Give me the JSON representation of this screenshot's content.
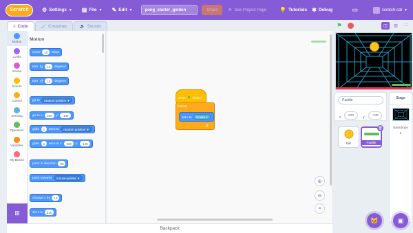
{
  "menu": {
    "logo": "Scratch",
    "settings": "Settings",
    "file": "File",
    "edit": "Edit",
    "project_title": "pong_starter_golden",
    "share": "Share",
    "see_project": "See Project Page",
    "tutorials": "Tutorials",
    "debug": "Debug",
    "username": "scratch-cat"
  },
  "tabs": [
    {
      "label": "Code",
      "icon": "code-icon",
      "active": true
    },
    {
      "label": "Costumes",
      "icon": "brush-icon",
      "active": false
    },
    {
      "label": "Sounds",
      "icon": "speaker-icon",
      "active": false
    }
  ],
  "categories": [
    {
      "label": "Motion",
      "color": "#4c97ff"
    },
    {
      "label": "Looks",
      "color": "#9966ff"
    },
    {
      "label": "Sound",
      "color": "#cf63cf"
    },
    {
      "label": "Events",
      "color": "#ffbf00"
    },
    {
      "label": "Control",
      "color": "#ffab19"
    },
    {
      "label": "Sensing",
      "color": "#5cb1d6"
    },
    {
      "label": "Operators",
      "color": "#59c059"
    },
    {
      "label": "Variables",
      "color": "#ff8c1a"
    },
    {
      "label": "My Blocks",
      "color": "#ff6680"
    }
  ],
  "palette": {
    "heading": "Motion",
    "blocks": {
      "move": {
        "pre": "move",
        "val": "10",
        "post": "steps"
      },
      "turn_right": {
        "pre": "turn",
        "val": "15",
        "post": "degrees"
      },
      "turn_left": {
        "pre": "turn",
        "val": "15",
        "post": "degrees"
      },
      "goto": {
        "pre": "go to",
        "dd": "random position"
      },
      "goto_xy": {
        "pre": "go to x:",
        "x": "220",
        "mid": "y:",
        "y": "-145"
      },
      "glide_to": {
        "pre": "glide",
        "val": "1",
        "mid": "secs to",
        "dd": "random position"
      },
      "glide_xy": {
        "pre": "glide",
        "val": "1",
        "mid": "secs to x:",
        "x": "220",
        "mid2": "y:",
        "y": "-145"
      },
      "point_dir": {
        "pre": "point in direction",
        "val": "90"
      },
      "point_towards": {
        "pre": "point towards",
        "dd": "mouse-pointer"
      },
      "change_x": {
        "pre": "change x by",
        "val": "10"
      },
      "set_x": {
        "pre": "set x to",
        "val": "220"
      }
    }
  },
  "script": {
    "hat_pre": "when",
    "hat_post": "clicked",
    "forever": "forever",
    "setx_pre": "set x to",
    "setx_val": "mouse x"
  },
  "backpack": "Backpack",
  "sprite_info": {
    "name": "Paddle",
    "x_label": "x",
    "x": "220",
    "y_label": "y",
    "y": "-145"
  },
  "sprites": [
    {
      "name": "Ball",
      "selected": false
    },
    {
      "name": "Paddle",
      "selected": true
    }
  ],
  "stage_panel": {
    "heading": "Stage",
    "backdrops_label": "Backdrops",
    "backdrops_count": "2"
  },
  "colors": {
    "accent": "#855cd6",
    "motion": "#4c97ff",
    "events": "#ffbf00",
    "control": "#ffab19"
  }
}
